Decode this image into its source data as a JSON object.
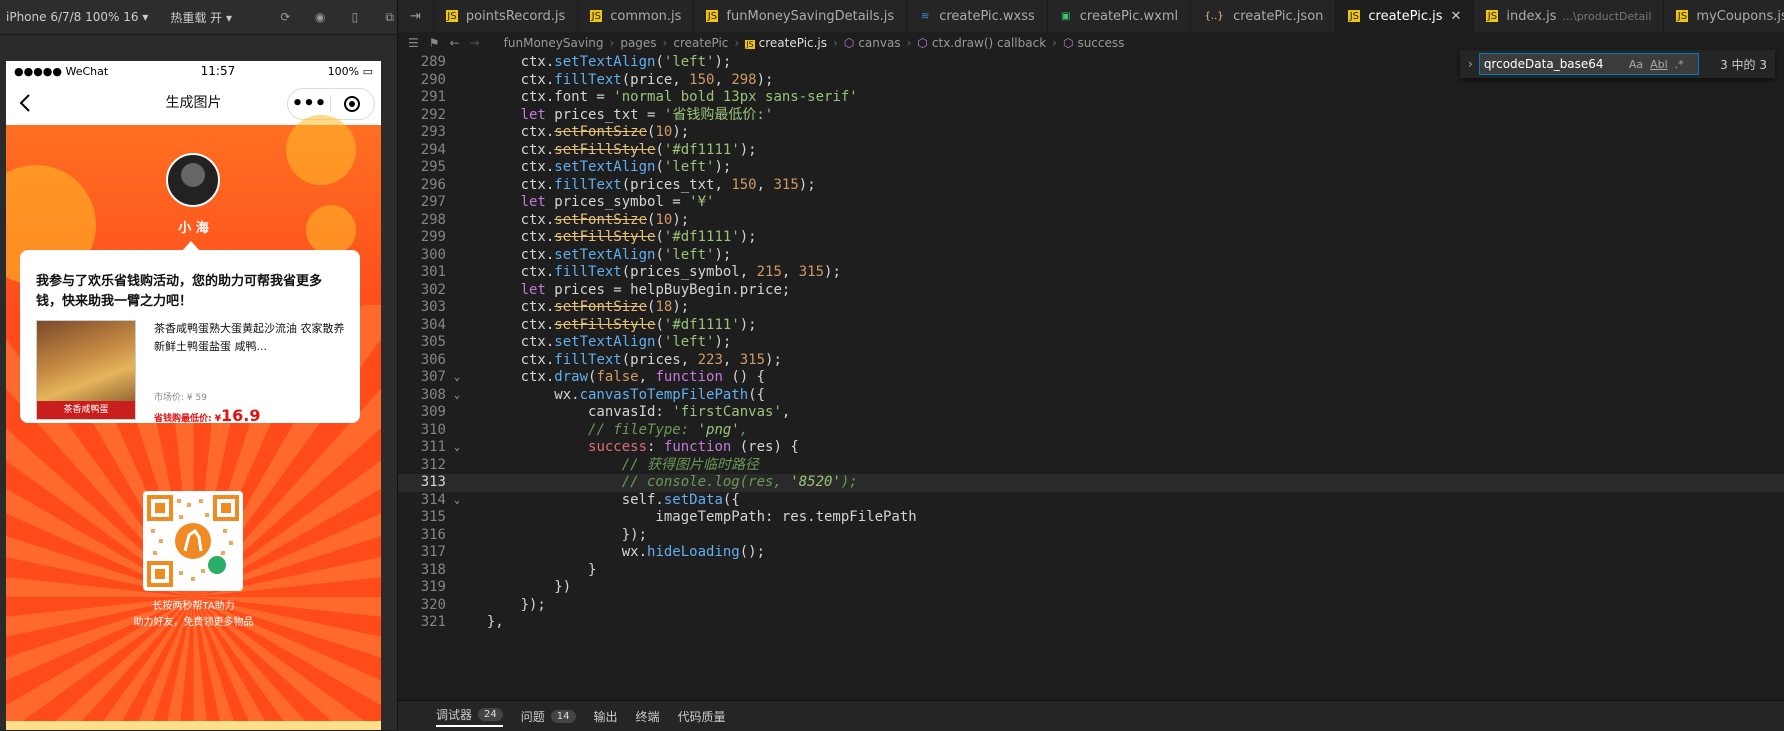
{
  "simulator": {
    "device": "iPhone 6/7/8 100% 16",
    "hotreload": "热重载 开",
    "status": {
      "carrier": "●●●●● WeChat",
      "time": "11:57",
      "battery": "100%"
    },
    "nav_title": "生成图片",
    "poster": {
      "nickname": "小 海",
      "message": "我参与了欢乐省钱购活动，您的助力可帮我省更多钱，快来助我一臂之力吧！",
      "product_title": "茶香咸鸭蛋熟大蛋黄起沙流油 农家散养新鲜土鸭蛋盐蛋 咸鸭...",
      "product_ribbon": "茶香咸鸭蛋",
      "market_price": "市场价: ¥ 59",
      "low_price_label": "省钱购最低价: ¥",
      "low_price_value": "16.9",
      "qr_caption_1": "长按两秒帮TA助力",
      "qr_caption_2": "助力好友，免费领更多物品"
    }
  },
  "editor": {
    "tabs": [
      {
        "label": "pointsRecord.js",
        "icon": "js-file-icon"
      },
      {
        "label": "common.js",
        "icon": "js-file-icon"
      },
      {
        "label": "funMoneySavingDetails.js",
        "icon": "js-file-icon"
      },
      {
        "label": "createPic.wxss",
        "icon": "css-file-icon"
      },
      {
        "label": "createPic.wxml",
        "icon": "wxml-file-icon"
      },
      {
        "label": "createPic.json",
        "icon": "json-file-icon"
      },
      {
        "label": "createPic.js",
        "icon": "js-file-icon"
      },
      {
        "label": "index.js",
        "icon": "js-file-icon",
        "hint": "...\\productDetail"
      },
      {
        "label": "myCoupons.js",
        "icon": "js-file-icon"
      }
    ],
    "breadcrumb": [
      "funMoneySaving",
      "pages",
      "createPic",
      "createPic.js",
      "canvas",
      "ctx.draw() callback",
      "success"
    ],
    "find": {
      "value": "qrcodeData_base64",
      "count": "3 中的 3",
      "opt_case": "Aa",
      "opt_word": "Abl",
      "opt_regex": ".*"
    },
    "bottom": [
      {
        "label": "调试器",
        "badge": "24"
      },
      {
        "label": "问题",
        "badge": "14"
      },
      {
        "label": "输出",
        "badge": ""
      },
      {
        "label": "终端",
        "badge": ""
      },
      {
        "label": "代码质量",
        "badge": ""
      }
    ],
    "lines": [
      {
        "n": "289",
        "t": "      ctx.setTextAlign('left');"
      },
      {
        "n": "290",
        "t": "      ctx.fillText(price, 150, 298);"
      },
      {
        "n": "291",
        "t": "      ctx.font = 'normal bold 13px sans-serif'"
      },
      {
        "n": "292",
        "t": "      let prices_txt = '省钱购最低价:'"
      },
      {
        "n": "293",
        "t": "      ctx.setFontSize(10);"
      },
      {
        "n": "294",
        "t": "      ctx.setFillStyle('#df1111');"
      },
      {
        "n": "295",
        "t": "      ctx.setTextAlign('left');"
      },
      {
        "n": "296",
        "t": "      ctx.fillText(prices_txt, 150, 315);"
      },
      {
        "n": "297",
        "t": "      let prices_symbol = '¥'"
      },
      {
        "n": "298",
        "t": "      ctx.setFontSize(10);"
      },
      {
        "n": "299",
        "t": "      ctx.setFillStyle('#df1111');"
      },
      {
        "n": "300",
        "t": "      ctx.setTextAlign('left');"
      },
      {
        "n": "301",
        "t": "      ctx.fillText(prices_symbol, 215, 315);"
      },
      {
        "n": "302",
        "t": "      let prices = helpBuyBegin.price;"
      },
      {
        "n": "303",
        "t": "      ctx.setFontSize(18);"
      },
      {
        "n": "304",
        "t": "      ctx.setFillStyle('#df1111');"
      },
      {
        "n": "305",
        "t": "      ctx.setTextAlign('left');"
      },
      {
        "n": "306",
        "t": "      ctx.fillText(prices, 223, 315);"
      },
      {
        "n": "307",
        "t": "      ctx.draw(false, function () {"
      },
      {
        "n": "308",
        "t": "          wx.canvasToTempFilePath({"
      },
      {
        "n": "309",
        "t": "              canvasId: 'firstCanvas',"
      },
      {
        "n": "310",
        "t": "              // fileType: 'png',"
      },
      {
        "n": "311",
        "t": "              success: function (res) {"
      },
      {
        "n": "312",
        "t": "                  // 获得图片临时路径"
      },
      {
        "n": "313",
        "t": "                  // console.log(res, '8520');"
      },
      {
        "n": "314",
        "t": "                  self.setData({"
      },
      {
        "n": "315",
        "t": "                      imageTempPath: res.tempFilePath"
      },
      {
        "n": "316",
        "t": "                  });"
      },
      {
        "n": "317",
        "t": "                  wx.hideLoading();"
      },
      {
        "n": "318",
        "t": "              }"
      },
      {
        "n": "319",
        "t": "          })"
      },
      {
        "n": "320",
        "t": "      });"
      },
      {
        "n": "321",
        "t": "  },"
      }
    ]
  }
}
